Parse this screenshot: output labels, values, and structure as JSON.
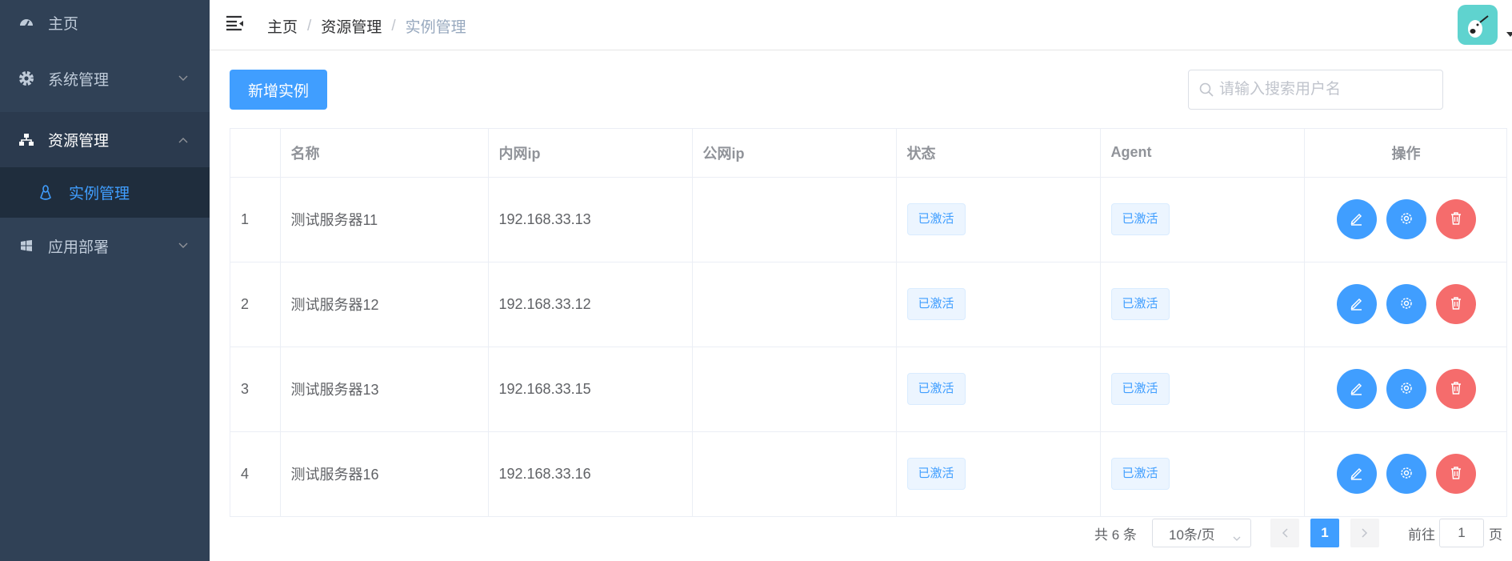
{
  "sidebar": {
    "items": [
      {
        "label": "主页",
        "icon": "dashboard-icon"
      },
      {
        "label": "系统管理",
        "icon": "gear-icon",
        "expandable": true
      },
      {
        "label": "资源管理",
        "icon": "network-icon",
        "expandable": true,
        "expanded": true
      },
      {
        "label": "实例管理",
        "icon": "linux-icon",
        "sub": true,
        "active": true
      },
      {
        "label": "应用部署",
        "icon": "windows-icon",
        "expandable": true
      }
    ]
  },
  "header": {
    "breadcrumb": [
      "主页",
      "资源管理",
      "实例管理"
    ],
    "separator": "/"
  },
  "toolbar": {
    "add_label": "新增实例",
    "search_placeholder": "请输入搜索用户名"
  },
  "table": {
    "columns": [
      "",
      "名称",
      "内网ip",
      "公网ip",
      "状态",
      "Agent",
      "操作"
    ],
    "rows": [
      {
        "index": "1",
        "name": "测试服务器11",
        "private_ip": "192.168.33.13",
        "public_ip": "",
        "status": "已激活",
        "agent": "已激活"
      },
      {
        "index": "2",
        "name": "测试服务器12",
        "private_ip": "192.168.33.12",
        "public_ip": "",
        "status": "已激活",
        "agent": "已激活"
      },
      {
        "index": "3",
        "name": "测试服务器13",
        "private_ip": "192.168.33.15",
        "public_ip": "",
        "status": "已激活",
        "agent": "已激活"
      },
      {
        "index": "4",
        "name": "测试服务器16",
        "private_ip": "192.168.33.16",
        "public_ip": "",
        "status": "已激活",
        "agent": "已激活"
      }
    ]
  },
  "pagination": {
    "total": "共 6 条",
    "page_size": "10条/页",
    "current_page": "1",
    "goto_label": "前往",
    "goto_value": "1",
    "goto_unit": "页"
  },
  "colors": {
    "sidebar_bg": "#304156",
    "primary": "#409eff",
    "danger": "#f56c6c",
    "avatar_bg": "#5fd3cf"
  }
}
